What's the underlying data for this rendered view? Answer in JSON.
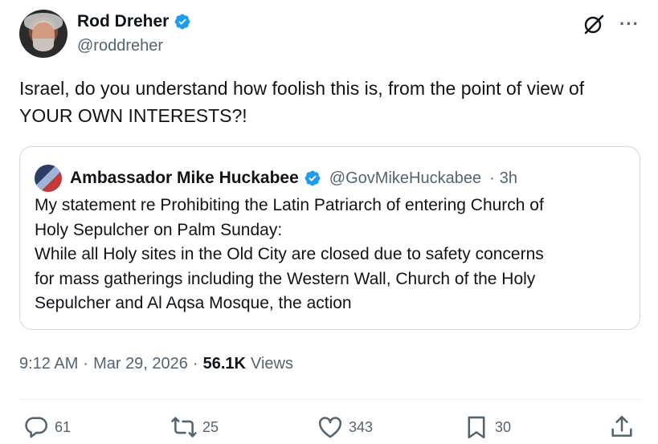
{
  "author": {
    "display_name": "Rod Dreher",
    "handle": "@roddreher"
  },
  "tweet": {
    "text": "Israel, do you understand how foolish this is, from the point of view of YOUR OWN INTERESTS?!"
  },
  "quoted": {
    "display_name": "Ambassador Mike Huckabee",
    "handle": "@GovMikeHuckabee",
    "separator": "·",
    "time_ago": "3h",
    "lines": [
      "My statement re Prohibiting the Latin Patriarch of entering Church of",
      "Holy Sepulcher on Palm Sunday:",
      "While all Holy sites in the Old City are closed due to safety concerns",
      "for mass gatherings including the Western Wall, Church of the Holy",
      "Sepulcher and Al Aqsa Mosque, the action"
    ]
  },
  "meta": {
    "time": "9:12 AM",
    "sep1": "·",
    "date": "Mar 29, 2026",
    "sep2": "·",
    "views_count": "56.1K",
    "views_label": "Views"
  },
  "actions": {
    "replies": "61",
    "reposts": "25",
    "likes": "343",
    "bookmarks": "30"
  },
  "colors": {
    "verified": "#1d9bf0",
    "muted": "#536471",
    "border": "#cfd9de"
  },
  "icons": [
    "verified-badge-icon",
    "grok-icon",
    "more-icon",
    "reply-icon",
    "repost-icon",
    "like-icon",
    "bookmark-icon",
    "share-icon"
  ]
}
